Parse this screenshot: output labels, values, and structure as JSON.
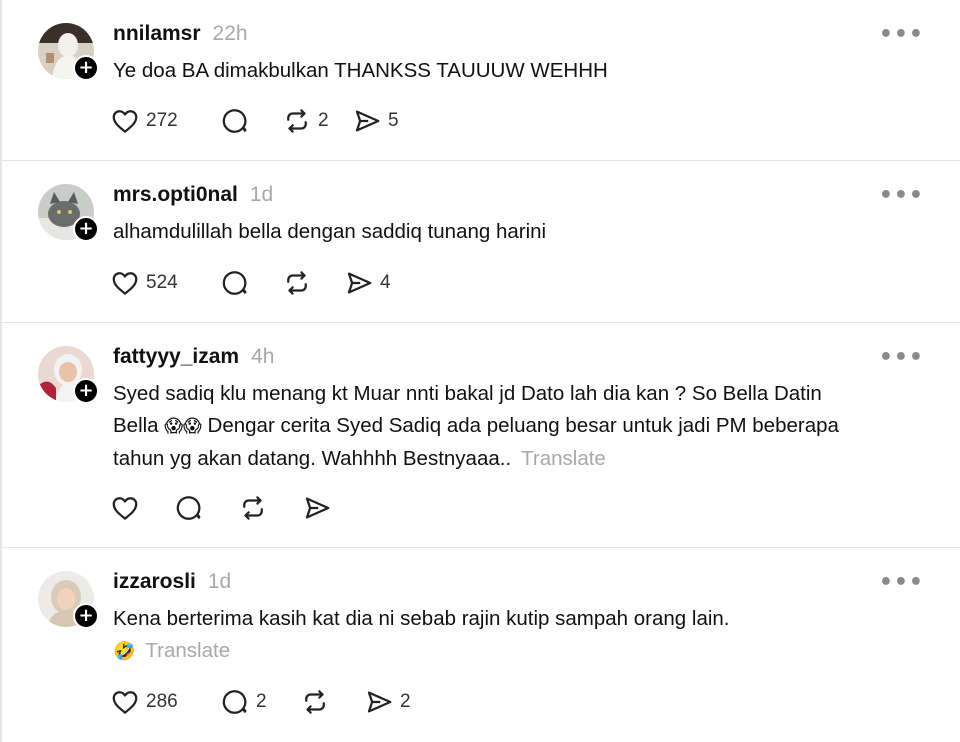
{
  "posts": [
    {
      "username": "nnilamsr",
      "time": "22h",
      "text": "Ye doa BA dimakbulkan THANKSS TAUUUW WEHHH",
      "likes": "272",
      "replies": "",
      "reposts": "2",
      "shares": "5"
    },
    {
      "username": "mrs.opti0nal",
      "time": "1d",
      "text": "alhamdulillah bella dengan saddiq tunang harini",
      "likes": "524",
      "replies": "",
      "reposts": "",
      "shares": "4"
    },
    {
      "username": "fattyyy_izam",
      "time": "4h",
      "text_line1": "Syed sadiq klu menang kt Muar nnti bakal jd Dato lah dia kan ? So Bella Datin",
      "text_line2_a": "Bella",
      "text_line2_emoji": "😱😱",
      "text_line2_b": "Dengar cerita Syed Sadiq ada peluang besar untuk jadi PM beberapa",
      "text_line3": "tahun yg akan datang. Wahhhh Bestnyaaa..",
      "translate": "Translate",
      "likes": "",
      "replies": "",
      "reposts": "",
      "shares": ""
    },
    {
      "username": "izzarosli",
      "time": "1d",
      "text": "Kena berterima kasih kat dia ni sebab rajin kutip sampah orang lain.",
      "emoji": "🤣",
      "translate": "Translate",
      "likes": "286",
      "replies": "2",
      "reposts": "",
      "shares": "2"
    }
  ],
  "icons": {
    "like": "heart-icon",
    "reply": "comment-icon",
    "repost": "repost-icon",
    "share": "send-icon",
    "more": "more-horizontal-icon",
    "follow": "plus-icon"
  },
  "ui": {
    "more_glyph": "•••",
    "follow_glyph": "+"
  }
}
